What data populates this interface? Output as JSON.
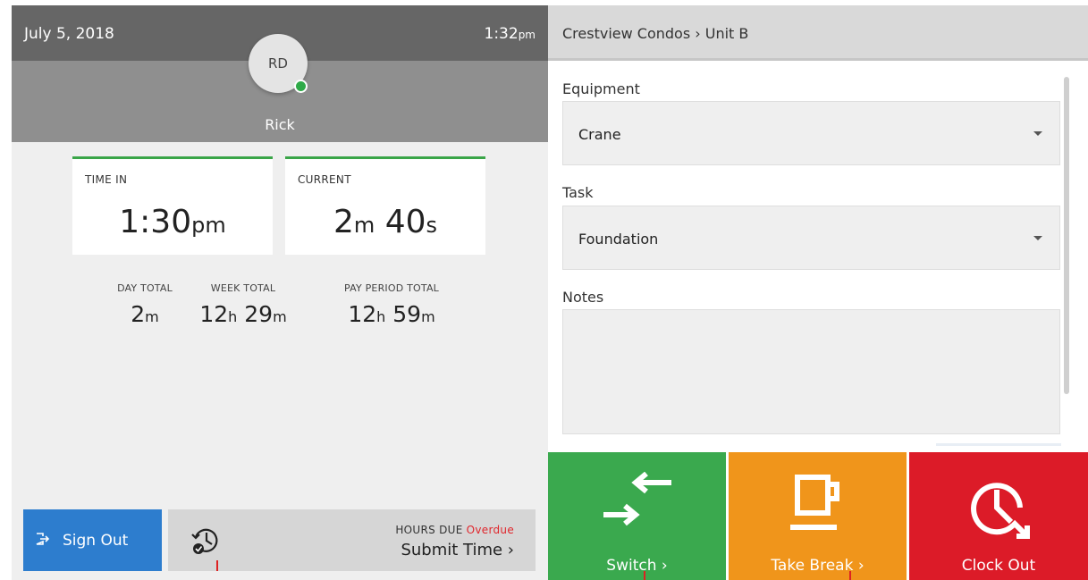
{
  "header": {
    "date": "July 5, 2018",
    "time": "1:32",
    "time_ampm": "pm",
    "avatar_initials": "RD",
    "user_name": "Rick"
  },
  "cards": {
    "time_in": {
      "label": "TIME IN",
      "value": "1:30",
      "unit": "pm"
    },
    "current": {
      "label": "CURRENT",
      "minutes": "2",
      "minutes_unit": "m",
      "seconds": "40",
      "seconds_unit": "s"
    }
  },
  "totals": {
    "day": {
      "label": "DAY TOTAL",
      "m": "2",
      "m_unit": "m"
    },
    "week": {
      "label": "WEEK TOTAL",
      "h": "12",
      "h_unit": "h",
      "m": "29",
      "m_unit": "m"
    },
    "pay_period": {
      "label": "PAY PERIOD TOTAL",
      "h": "12",
      "h_unit": "h",
      "m": "59",
      "m_unit": "m"
    }
  },
  "footer": {
    "sign_out_label": "Sign Out",
    "hours_due_label": "HOURS DUE",
    "hours_due_status": "Overdue",
    "submit_label": "Submit Time ›"
  },
  "form": {
    "breadcrumb": "Crestview Condos › Unit B",
    "equipment_label": "Equipment",
    "equipment_value": "Crane",
    "task_label": "Task",
    "task_value": "Foundation",
    "notes_label": "Notes",
    "notes_value": ""
  },
  "actions": {
    "switch_label": "Switch ›",
    "break_label": "Take Break ›",
    "clock_out_label": "Clock Out"
  },
  "colors": {
    "accent_green": "#3aa548",
    "sign_out_blue": "#2d7dce",
    "overdue_red": "#e0262c",
    "switch_green": "#3aa94e",
    "break_orange": "#f0951b",
    "clock_out_red": "#dc1b28"
  },
  "icons": {
    "sign_out": "sign-out-icon",
    "history": "history-icon",
    "switch": "switch-arrows-icon",
    "break": "coffee-cup-icon",
    "clock_out": "clock-out-icon",
    "dropdown": "caret-down-icon"
  }
}
